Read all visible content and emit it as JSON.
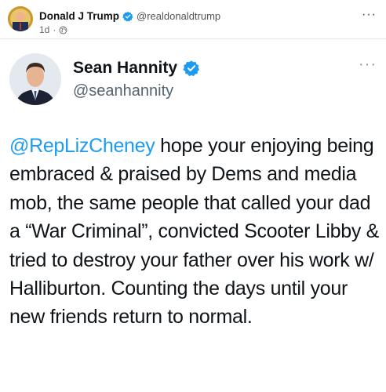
{
  "post": {
    "author_name": "Donald J Trump",
    "author_handle": "@realdonaldtrump",
    "timestamp": "1d",
    "separator": "·",
    "more": "···",
    "icons": [
      "verified-badge-icon",
      "globe-icon",
      "more-options-icon"
    ]
  },
  "tweet": {
    "name": "Sean Hannity",
    "handle": "@seanhannity",
    "more": "···",
    "mention": "@RepLizCheney",
    "text": " hope your enjoying being embraced & praised by Dems and media mob, the same people that called your dad a “War Criminal”, convicted Scooter Libby & tried to destroy your father over his work w/ Halliburton. Counting the days until your new friends return to normal.",
    "icons": [
      "verified-badge-icon",
      "more-options-icon"
    ]
  },
  "colors": {
    "link": "#1d9bf0",
    "verified": "#1d9bf0",
    "text": "#0f1419",
    "secondary": "#536471"
  }
}
